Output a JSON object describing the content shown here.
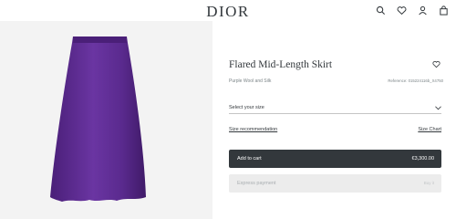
{
  "header": {
    "logo": "DIOR",
    "icons": [
      "search-icon",
      "heart-icon",
      "user-icon",
      "bag-icon"
    ]
  },
  "product": {
    "title": "Flared Mid-Length Skirt",
    "subtitle": "Purple Wool and Silk",
    "reference": "Reference: 015224116b_X4750",
    "size_label": "Select your size",
    "size_recommendation": "Size recommendation",
    "size_chart": "Size Chart",
    "add_to_cart": "Add to cart",
    "price": "€3,300.00",
    "express_payment": "Express payment",
    "express_hint": "Buy it"
  },
  "colors": {
    "skirt": "#5a2a8e",
    "dark_button": "#33383c",
    "image_background": "#f3f3f3"
  }
}
